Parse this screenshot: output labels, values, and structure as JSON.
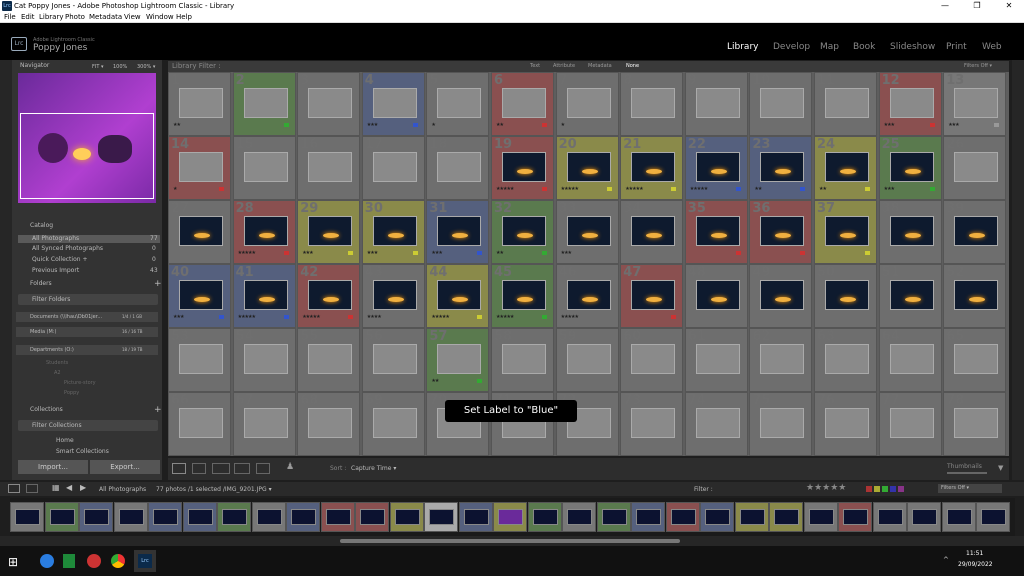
{
  "window": {
    "title": "Cat Poppy Jones - Adobe Photoshop Lightroom Classic - Library",
    "icon": "Lrc",
    "minimize": "—",
    "maximize": "❐",
    "close": "✕"
  },
  "menu": [
    "File",
    "Edit",
    "Library",
    "Photo",
    "Metadata",
    "View",
    "Window",
    "Help"
  ],
  "identity": {
    "app": "Adobe Lightroom Classic",
    "user": "Poppy Jones",
    "badge": "Lrc"
  },
  "modules": [
    "Library",
    "Develop",
    "Map",
    "Book",
    "Slideshow",
    "Print",
    "Web"
  ],
  "navigator": {
    "title": "Navigator",
    "zooms": [
      "FIT ▾",
      "100%",
      "300% ▾"
    ]
  },
  "catalog": {
    "title": "Catalog",
    "items": [
      {
        "label": "All Photographs",
        "count": "77"
      },
      {
        "label": "All Synced Photographs",
        "count": "0"
      },
      {
        "label": "Quick Collection +",
        "count": "0"
      },
      {
        "label": "Previous Import",
        "count": "43"
      }
    ]
  },
  "folders": {
    "title": "Folders",
    "filter": "Filter Folders",
    "volumes": [
      {
        "label": "Documents (\\\\lhau\\Db01jer...",
        "size": "1/4 / 1 GB"
      },
      {
        "label": "Media (M:)",
        "size": "16 / 16 TB"
      },
      {
        "label": "Departments (O:)",
        "size": "18 / 19 TB"
      }
    ],
    "sub": [
      "Students",
      "A2",
      "Picture-story",
      "Poppy"
    ]
  },
  "collections": {
    "title": "Collections",
    "filter": "Filter Collections",
    "items": [
      "Home",
      "Smart Collections"
    ]
  },
  "panel_buttons": {
    "import": "Import...",
    "export": "Export..."
  },
  "filter_bar": {
    "title": "Library Filter :",
    "tabs": [
      "Text",
      "Attribute",
      "Metadata",
      "None"
    ],
    "right": "Filters Off ▾"
  },
  "grid": {
    "rows": [
      {
        "start": 1,
        "labels": [
          "",
          "green",
          "",
          "blue",
          "",
          "red",
          "",
          "",
          "",
          "",
          "",
          "red",
          "gray"
        ],
        "stars": [
          "★★",
          "",
          "",
          "★★★",
          "★",
          "★★",
          "★",
          "",
          "",
          "",
          "",
          "★★★",
          "★★★"
        ]
      },
      {
        "start": 14,
        "labels": [
          "red",
          "",
          "",
          "",
          "",
          "red",
          "yellow",
          "yellow",
          "blue",
          "blue",
          "yellow",
          "green",
          ""
        ],
        "stars": [
          "★",
          "",
          "",
          "",
          "",
          "★★★★★",
          "★★★★★",
          "★★★★★",
          "★★★★★",
          "★★",
          "★★",
          "★★★",
          ""
        ]
      },
      {
        "start": 27,
        "labels": [
          "",
          "red",
          "yellow",
          "yellow",
          "blue",
          "green",
          "",
          "",
          "red",
          "red",
          "yellow",
          "",
          ""
        ],
        "stars": [
          "",
          "★★★★★",
          "★★★",
          "★★★",
          "★★★",
          "★★",
          "★★★",
          "",
          "",
          "",
          "",
          "",
          ""
        ]
      },
      {
        "start": 40,
        "labels": [
          "blue",
          "blue",
          "red",
          "",
          "yellow",
          "green",
          "",
          "red",
          "",
          "",
          "",
          "",
          ""
        ],
        "stars": [
          "★★★",
          "★★★★★",
          "★★★★★",
          "★★★★",
          "★★★★★",
          "★★★★★",
          "★★★★★",
          "",
          "",
          "",
          "",
          "",
          ""
        ]
      },
      {
        "start": 53,
        "labels": [
          "",
          "",
          "",
          "",
          "green",
          "",
          "",
          "",
          "",
          "",
          "",
          "",
          ""
        ],
        "stars": [
          "",
          "",
          "",
          "",
          "★★",
          "",
          "",
          "",
          "",
          "",
          "",
          "",
          ""
        ]
      },
      {
        "start": 66,
        "labels": [
          "",
          "",
          "",
          "",
          "",
          "",
          "",
          "",
          "",
          "",
          "",
          "",
          ""
        ],
        "stars": [
          "",
          "",
          "",
          "",
          "",
          "",
          "",
          "",
          "",
          "",
          "",
          "",
          ""
        ]
      }
    ],
    "tooltip": "Set Label to \"Blue\""
  },
  "toolbar": {
    "sort_label": "Sort :",
    "sort_value": "Capture Time ▾",
    "thumbnails": "Thumbnails"
  },
  "filmstrip": {
    "source": "All Photographs",
    "info": "77 photos /1 selected /IMG_9201.JPG ▾",
    "filter_label": "Filter :",
    "filter_state": "Filters Off ▾"
  },
  "taskbar": {
    "time": "11:51",
    "date": "29/09/2022"
  }
}
